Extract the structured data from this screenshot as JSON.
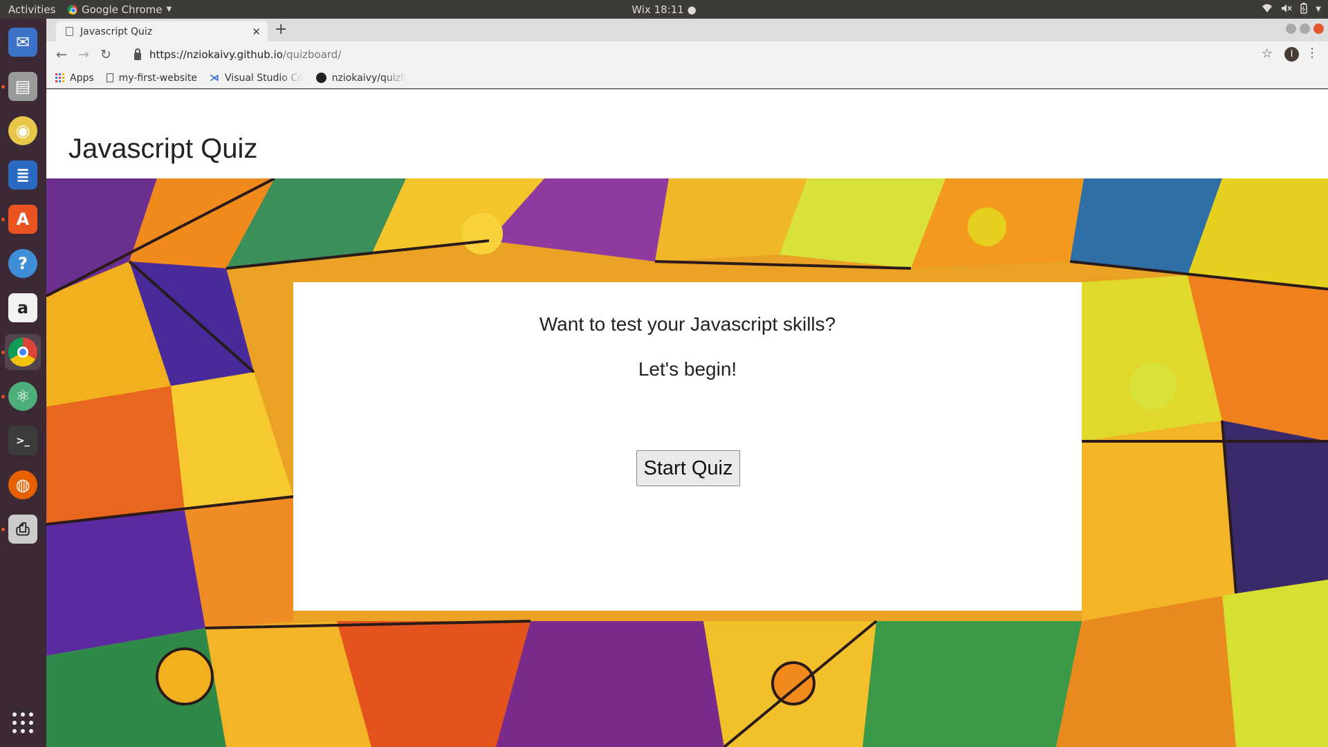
{
  "system_bar": {
    "activities": "Activities",
    "app_name": "Google Chrome",
    "clock": "Wix 18:11 ●",
    "tray_icons": [
      "wifi-icon",
      "volume-muted-icon",
      "battery-icon",
      "power-menu-icon"
    ]
  },
  "dock": {
    "items": [
      {
        "name": "thunderbird",
        "icon": "mail-icon",
        "color": "#3b73c8",
        "running": false
      },
      {
        "name": "files",
        "icon": "file-cabinet-icon",
        "color": "#9a9a9a",
        "running": true
      },
      {
        "name": "rhythmbox",
        "icon": "speaker-icon",
        "color": "#e7c649",
        "running": false
      },
      {
        "name": "libreoffice-writer",
        "icon": "document-icon",
        "color": "#2a6ac2",
        "running": false
      },
      {
        "name": "ubuntu-software",
        "icon": "shopping-bag-icon",
        "color": "#e95420",
        "running": true
      },
      {
        "name": "help",
        "icon": "question-icon",
        "color": "#3e8fd8",
        "running": false
      },
      {
        "name": "amazon",
        "icon": "amazon-icon",
        "color": "#f2f2f2",
        "running": false
      },
      {
        "name": "google-chrome",
        "icon": "chrome-icon",
        "color": "#4285f4",
        "running": true
      },
      {
        "name": "atom",
        "icon": "atom-icon",
        "color": "#4caf7a",
        "running": true
      },
      {
        "name": "terminal",
        "icon": "terminal-icon",
        "color": "#3c3c3c",
        "running": false
      },
      {
        "name": "firefox",
        "icon": "firefox-icon",
        "color": "#e66000",
        "running": false
      },
      {
        "name": "printer",
        "icon": "printer-icon",
        "color": "#cccccc",
        "running": true
      }
    ],
    "show_apps_icon": "grid-icon"
  },
  "browser": {
    "tab_title": "Javascript Quiz",
    "url_host": "https://nziokaivy.github.io",
    "url_path": "/quizboard/",
    "profile_initial": "I",
    "bookmarks": [
      "Apps",
      "my-first-website",
      "Visual Studio Co",
      "nziokaivy/quizb"
    ]
  },
  "page": {
    "site_title": "Javascript Quiz",
    "prompt": "Want to test your Javascript skills?",
    "subprompt": "Let's begin!",
    "start_button": "Start Quiz"
  },
  "colors": {
    "dock_bg": "#3b2a35",
    "topbar_bg": "#3c3b37",
    "accent": "#e95420"
  }
}
